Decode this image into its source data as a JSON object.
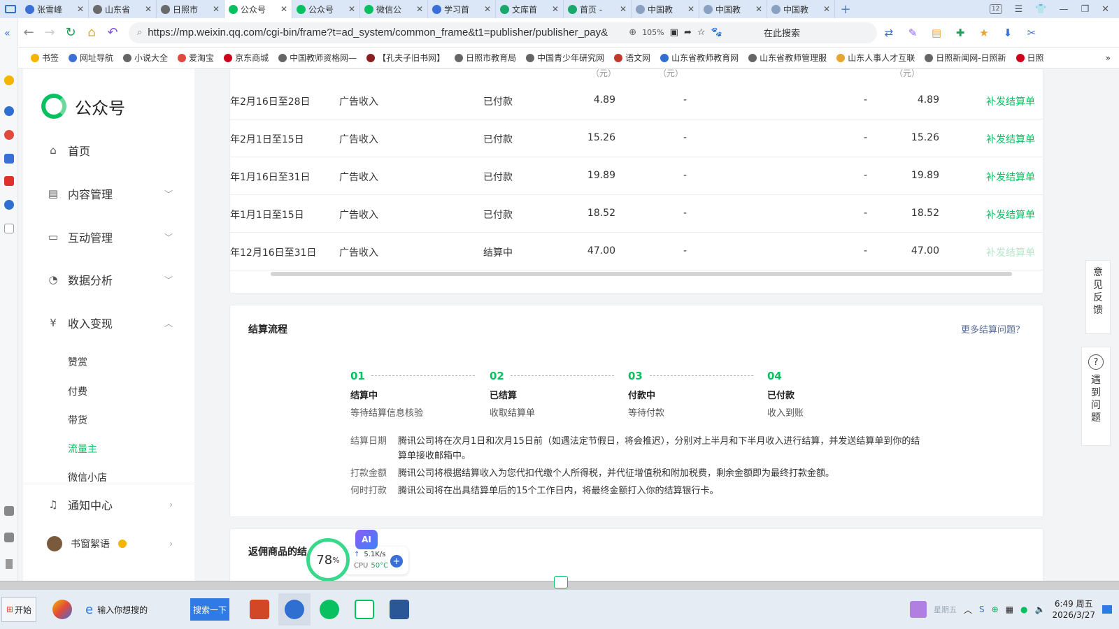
{
  "browser": {
    "tabs": [
      {
        "title": "张雪峰",
        "color": "#3a6fd8",
        "active": false
      },
      {
        "title": "山东省",
        "color": "#6a6a6a",
        "active": false
      },
      {
        "title": "日照市",
        "color": "#6a6a6a",
        "active": false
      },
      {
        "title": "公众号",
        "color": "#07c160",
        "active": true
      },
      {
        "title": "公众号",
        "color": "#07c160",
        "active": false
      },
      {
        "title": "微信公",
        "color": "#07c160",
        "active": false
      },
      {
        "title": "学习首",
        "color": "#3a6fd8",
        "active": false
      },
      {
        "title": "文库首",
        "color": "#1aa86a",
        "active": false
      },
      {
        "title": "首页 -",
        "color": "#1aa86a",
        "active": false
      },
      {
        "title": "中国教",
        "color": "#8aa0c0",
        "active": false
      },
      {
        "title": "中国教",
        "color": "#8aa0c0",
        "active": false
      },
      {
        "title": "中国教",
        "color": "#8aa0c0",
        "active": false
      }
    ],
    "tab_badge": "12",
    "url": "https://mp.weixin.qq.com/cgi-bin/frame?t=ad_system/common_frame&t1=publisher/publisher_pay&",
    "zoom": "105%",
    "search_placeholder": "在此搜索",
    "bookmarks": [
      "书签",
      "网址导航",
      "小说大全",
      "爱淘宝",
      "京东商城",
      "中国教师资格网—",
      "【孔夫子旧书网】",
      "日照市教育局",
      "中国青少年研究网",
      "语文网",
      "山东省教师教育网",
      "山东省教师管理服",
      "山东人事人才互联",
      "日照新闻网-日照新",
      "日照"
    ]
  },
  "nav": {
    "logo_text": "公众号",
    "items": {
      "home": "首页",
      "content": "内容管理",
      "interaction": "互动管理",
      "analytics": "数据分析",
      "monetization": "收入变现",
      "notifications": "通知中心"
    },
    "sub_items": [
      "赞赏",
      "付费",
      "带货",
      "流量主",
      "微信小店"
    ],
    "account_name": "书窗絮语"
  },
  "table": {
    "header_fragments": [
      "（元）",
      "（元）",
      "（元）"
    ],
    "rows": [
      {
        "period": "年2月16日至28日",
        "type": "广告收入",
        "status": "已付款",
        "amount": "4.89",
        "deduct": "-",
        "tax": "-",
        "final": "4.89",
        "action": "补发结算单",
        "action_enabled": true
      },
      {
        "period": "年2月1日至15日",
        "type": "广告收入",
        "status": "已付款",
        "amount": "15.26",
        "deduct": "-",
        "tax": "-",
        "final": "15.26",
        "action": "补发结算单",
        "action_enabled": true
      },
      {
        "period": "年1月16日至31日",
        "type": "广告收入",
        "status": "已付款",
        "amount": "19.89",
        "deduct": "-",
        "tax": "-",
        "final": "19.89",
        "action": "补发结算单",
        "action_enabled": true
      },
      {
        "period": "年1月1日至15日",
        "type": "广告收入",
        "status": "已付款",
        "amount": "18.52",
        "deduct": "-",
        "tax": "-",
        "final": "18.52",
        "action": "补发结算单",
        "action_enabled": true
      },
      {
        "period": "年12月16日至31日",
        "type": "广告收入",
        "status": "结算中",
        "amount": "47.00",
        "deduct": "-",
        "tax": "-",
        "final": "47.00",
        "action": "补发结算单",
        "action_enabled": false
      }
    ]
  },
  "flow": {
    "title": "结算流程",
    "more_link": "更多结算问题？",
    "steps": [
      {
        "num": "01",
        "title": "结算中",
        "desc": "等待结算信息核验"
      },
      {
        "num": "02",
        "title": "已结算",
        "desc": "收取结算单"
      },
      {
        "num": "03",
        "title": "付款中",
        "desc": "等待付款"
      },
      {
        "num": "04",
        "title": "已付款",
        "desc": "收入到账"
      }
    ],
    "notes": [
      {
        "key": "结算日期",
        "value": "腾讯公司将在次月1日和次月15日前（如遇法定节假日，将会推迟），分别对上半月和下半月收入进行结算，并发送结算单到你的结算单接收邮箱中。"
      },
      {
        "key": "打款金额",
        "value": "腾讯公司将根据结算收入为您代扣代缴个人所得税，并代征增值税和附加税费，剩余金额即为最终打款金额。"
      },
      {
        "key": "何时打款",
        "value": "腾讯公司将在出具结算单后的15个工作日内，将最终金额打入你的结算银行卡。"
      }
    ]
  },
  "bottom_section_title": "返佣商品的结",
  "floating": {
    "feedback": [
      "意",
      "见",
      "反",
      "馈"
    ],
    "help": [
      "遇",
      "到",
      "问",
      "题"
    ]
  },
  "monitor": {
    "percent": "78",
    "percent_unit": "%",
    "net_speed": "5.1K/s",
    "cpu_label": "CPU",
    "cpu_temp": "50°C",
    "ai_label": "AI"
  },
  "taskbar": {
    "start_label": "开始",
    "search_placeholder": "输入你想搜的",
    "search_button": "搜索一下",
    "tray_label": "星期五",
    "time": "6:49 周五",
    "date": "2026/3/27"
  }
}
